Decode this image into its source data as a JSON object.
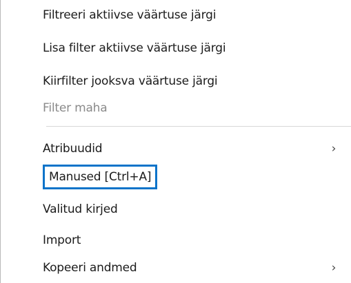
{
  "menu": {
    "items": [
      {
        "label": "Filtreeri aktiivse väärtuse järgi",
        "disabled": false
      },
      {
        "label": "Lisa filter aktiivse väärtuse järgi",
        "disabled": false
      },
      {
        "label": "Kiirfilter jooksva väärtuse järgi",
        "disabled": false
      },
      {
        "label": "Filter maha",
        "disabled": true
      },
      {
        "label": "Atribuudid",
        "submenu_arrow": "›"
      },
      {
        "label": "Manused [Ctrl+A]",
        "focused": true
      },
      {
        "label": "Valitud kirjed"
      },
      {
        "label": "Import"
      },
      {
        "label": "Kopeeri andmed",
        "submenu_arrow": "›"
      }
    ]
  },
  "colors": {
    "focus_border": "#0a73c9",
    "text": "#1b1b1b",
    "disabled_text": "#8a8a8a",
    "separator": "#d7d7d7"
  }
}
